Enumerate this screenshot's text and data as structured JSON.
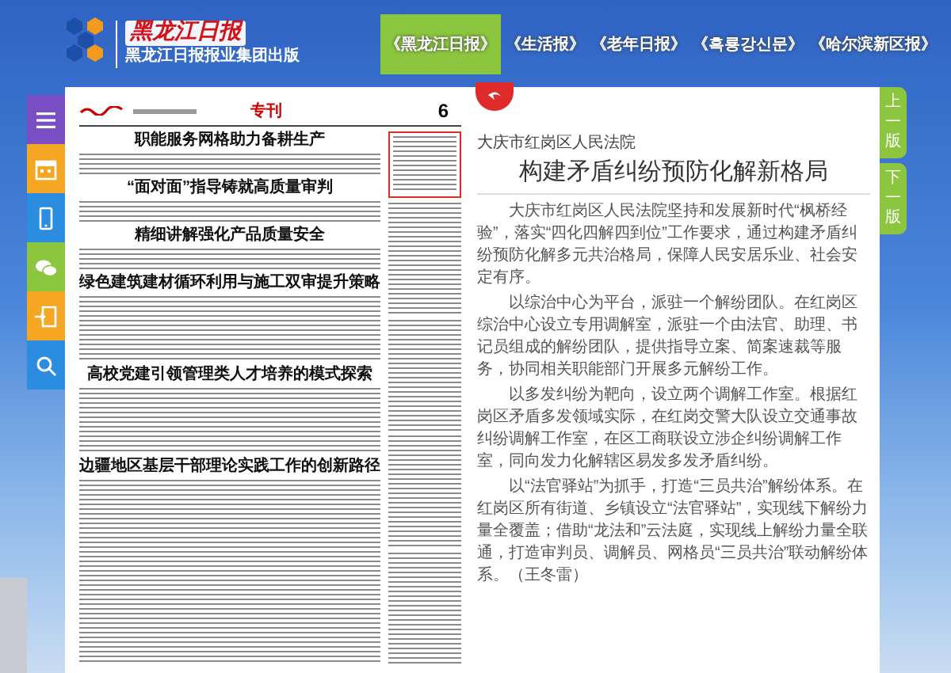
{
  "header": {
    "logo": {
      "title": "黑龙江日报",
      "subtitle": "黑龙江日报报业集团出版"
    },
    "tabs": [
      {
        "label": "《黑龙江日报》",
        "selected": true
      },
      {
        "label": "《生活报》",
        "selected": false
      },
      {
        "label": "《老年日报》",
        "selected": false
      },
      {
        "label": "《흑룡강신문》",
        "selected": false
      },
      {
        "label": "《哈尔滨新区报》",
        "selected": false
      }
    ]
  },
  "newspaper": {
    "section": "专刊",
    "page_number": "6",
    "headlines": [
      "职能服务网格助力备耕生产",
      "“面对面”指导铸就高质量审判",
      "精细讲解强化产品质量安全",
      "绿色建筑建材循环利用与施工双审提升策略",
      "高校党建引领管理类人才培养的模式探索",
      "边疆地区基层干部理论实践工作的创新路径"
    ]
  },
  "article": {
    "source": "大庆市红岗区人民法院",
    "title": "构建矛盾纠纷预防化解新格局",
    "paragraphs": [
      "大庆市红岗区人民法院坚持和发展新时代“枫桥经验”，落实“四化四解四到位”工作要求，通过构建矛盾纠纷预防化解多元共治格局，保障人民安居乐业、社会安定有序。",
      "以综治中心为平台，派驻一个解纷团队。在红岗区综治中心设立专用调解室，派驻一个由法官、助理、书记员组成的解纷团队，提供指导立案、简案速裁等服务，协同相关职能部门开展多元解纷工作。",
      "以多发纠纷为靶向，设立两个调解工作室。根据红岗区矛盾多发领域实际，在红岗交警大队设立交通事故纠纷调解工作室，在区工商联设立涉企纠纷调解工作室，同向发力化解辖区易发多发矛盾纠纷。",
      "以“法官驿站”为抓手，打造“三员共治”解纷体系。在红岗区所有街道、乡镇设立“法官驿站”，实现线下解纷力量全覆盖；借助“龙法和”云法庭，实现线上解纷力量全联通，打造审判员、调解员、网格员“三员共治”联动解纷体系。（王冬雷）"
    ]
  },
  "page_nav": [
    "上一版",
    "下一版"
  ]
}
